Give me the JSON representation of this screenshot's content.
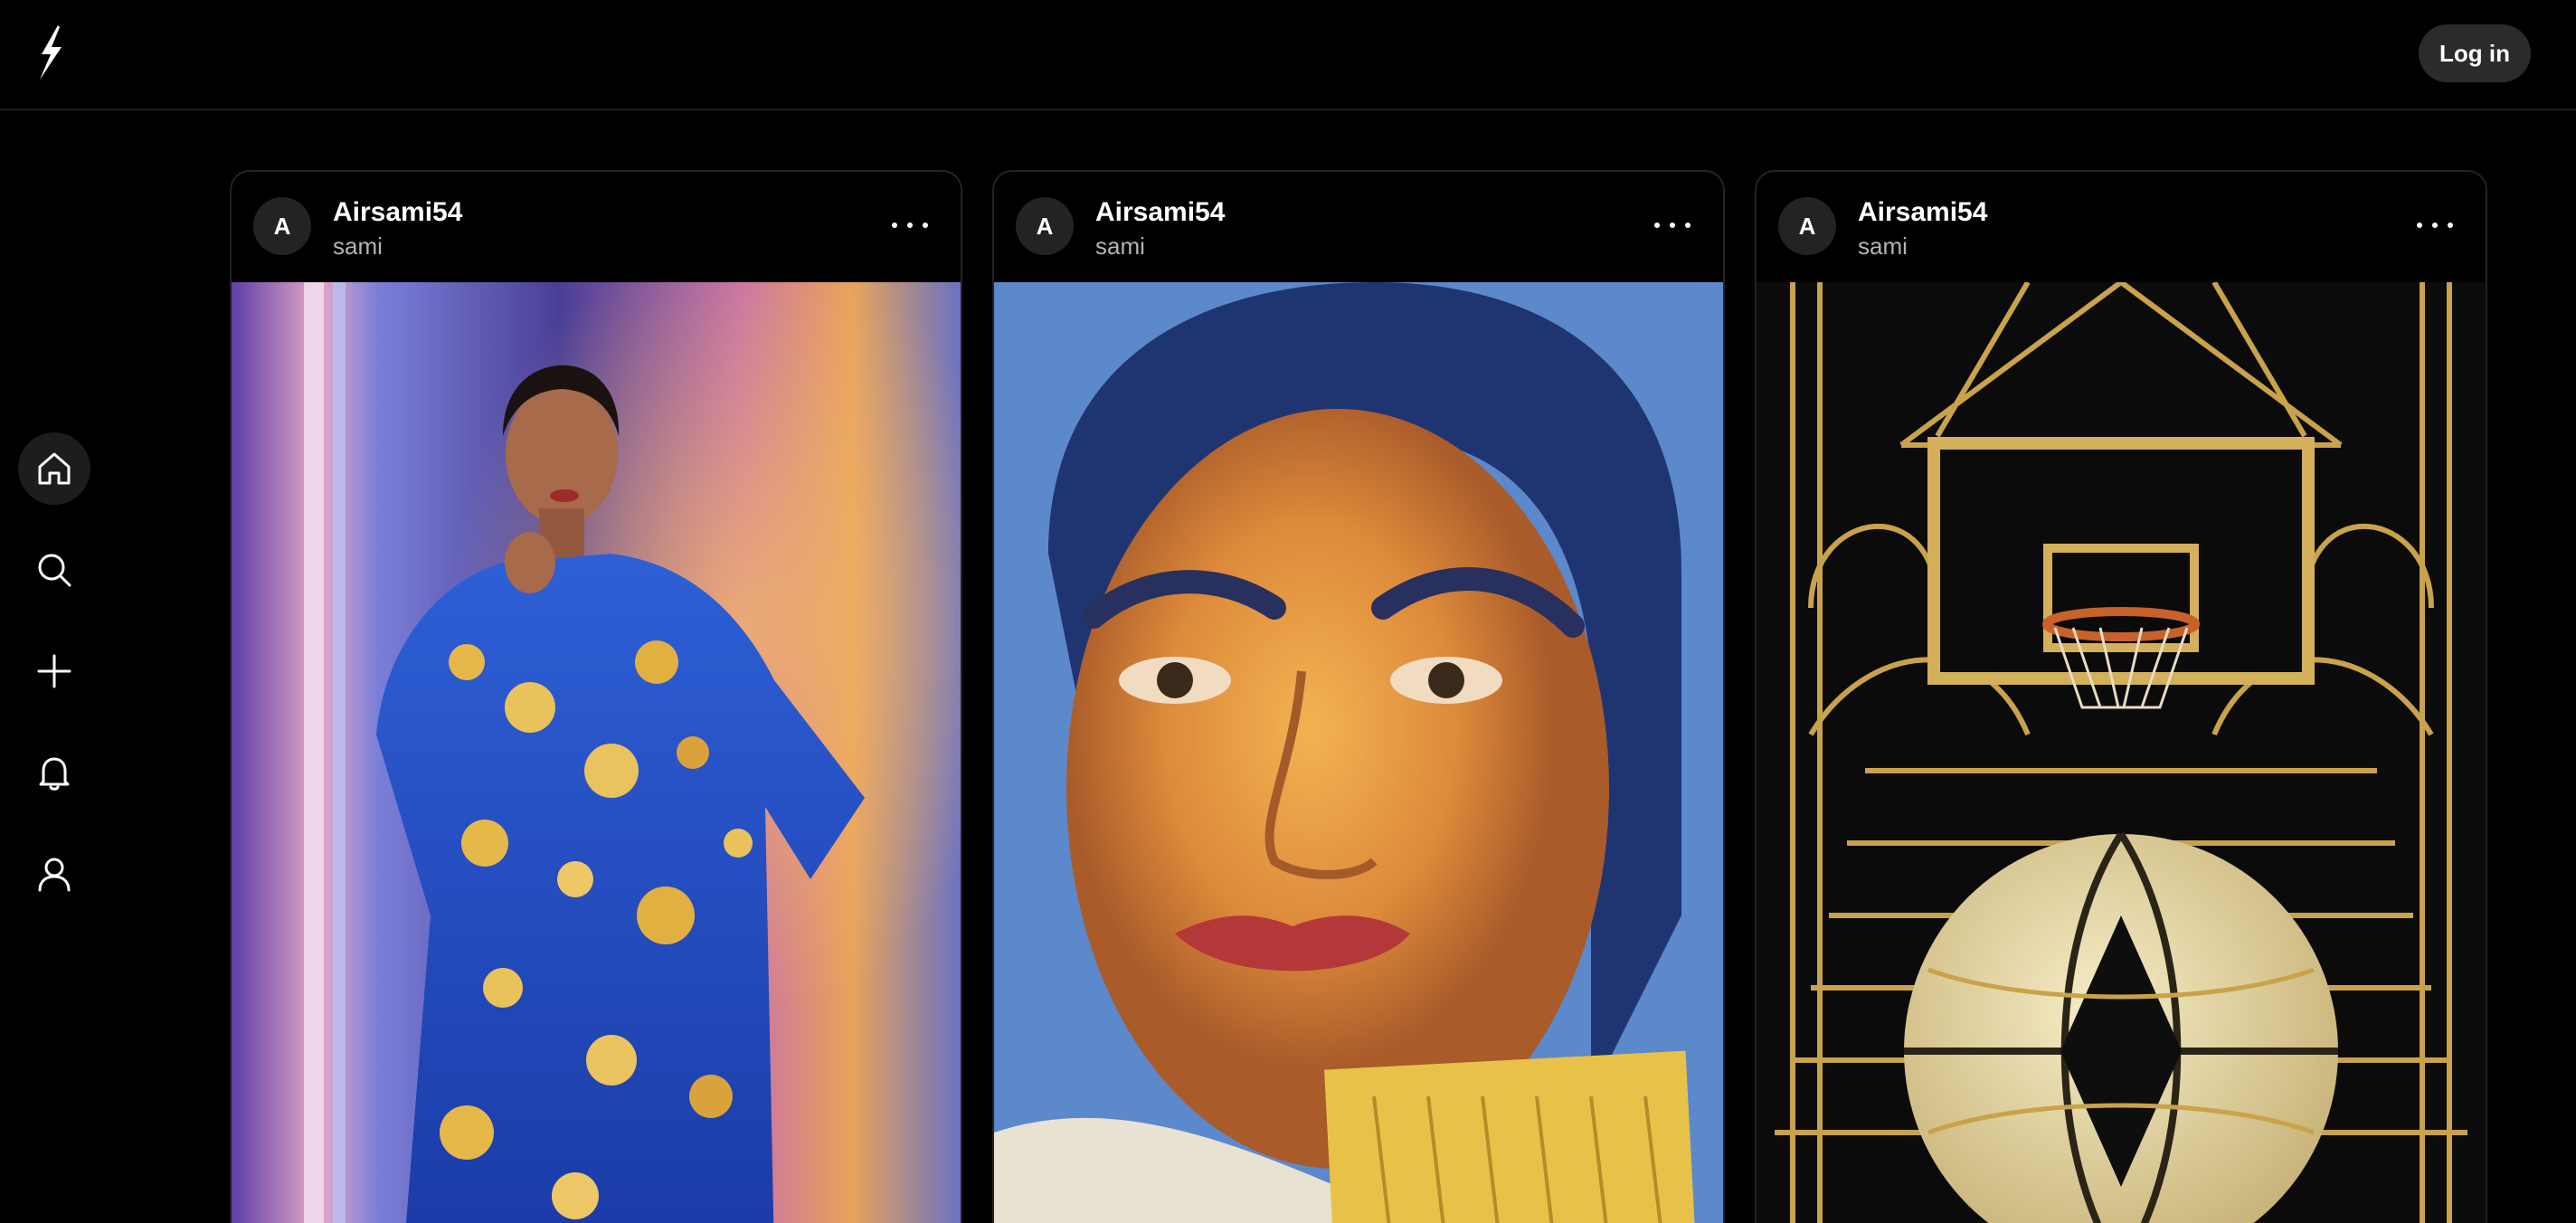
{
  "header": {
    "logo_icon": "lightning-bolt-icon",
    "login_label": "Log in"
  },
  "sidebar": {
    "items": [
      {
        "name": "home",
        "icon": "home-icon",
        "active": true
      },
      {
        "name": "search",
        "icon": "search-icon",
        "active": false
      },
      {
        "name": "create",
        "icon": "plus-icon",
        "active": false
      },
      {
        "name": "notifications",
        "icon": "bell-icon",
        "active": false
      },
      {
        "name": "profile",
        "icon": "user-icon",
        "active": false
      }
    ]
  },
  "feed": {
    "cards": [
      {
        "avatar_letter": "A",
        "username": "Airsami54",
        "handle": "sami",
        "menu_icon": "more-horizontal-icon",
        "image": "woman-in-blue-gold-dress-image"
      },
      {
        "avatar_letter": "A",
        "username": "Airsami54",
        "handle": "sami",
        "menu_icon": "more-horizontal-icon",
        "image": "impressionist-woman-portrait-image"
      },
      {
        "avatar_letter": "A",
        "username": "Airsami54",
        "handle": "sami",
        "menu_icon": "more-horizontal-icon",
        "image": "art-deco-basketball-image"
      }
    ]
  },
  "colors": {
    "background": "#000000",
    "button_bg": "#2b2b2b",
    "border": "#222222",
    "muted_text": "#b4b4b4"
  }
}
